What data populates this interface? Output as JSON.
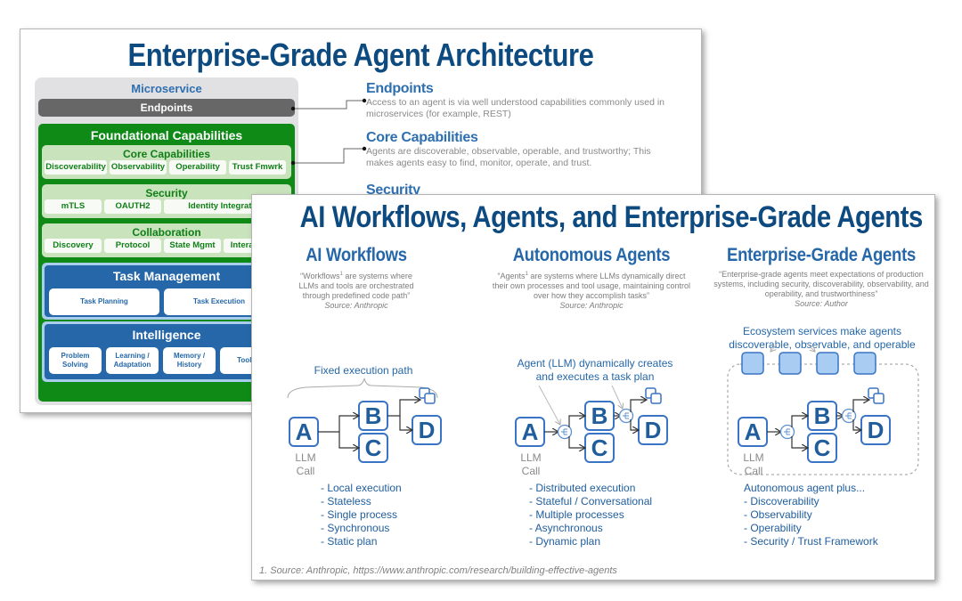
{
  "back_slide": {
    "title": "Enterprise-Grade Agent Architecture",
    "microservice_label": "Microservice",
    "endpoints_label": "Endpoints",
    "foundational_label": "Foundational Capabilities",
    "core": {
      "title": "Core Capabilities",
      "items": [
        "Discoverability",
        "Observability",
        "Operability",
        "Trust Fmwrk"
      ]
    },
    "security": {
      "title": "Security",
      "items": [
        "mTLS",
        "OAUTH2",
        "Identity Integration"
      ]
    },
    "collaboration": {
      "title": "Collaboration",
      "items": [
        "Discovery",
        "Protocol",
        "State Mgmt",
        "Interaction"
      ]
    },
    "task_management": {
      "title": "Task Management",
      "items": [
        "Task Planning",
        "Task Execution"
      ]
    },
    "intelligence": {
      "title": "Intelligence",
      "items": [
        "Problem Solving",
        "Learning / Adaptation",
        "Memory / History",
        "Tools"
      ]
    },
    "descriptions": [
      {
        "heading": "Endpoints",
        "text": "Access to an agent is via well understood capabilities commonly used in microservices (for example, REST)"
      },
      {
        "heading": "Core Capabilities",
        "text": "Agents are discoverable, observable, operable, and trustworthy; This makes agents easy to find, monitor, operate, and trust."
      },
      {
        "heading": "Security",
        "text": ""
      }
    ]
  },
  "front_slide": {
    "title": "AI Workflows, Agents, and Enterprise-Grade Agents",
    "columns": [
      {
        "heading": "AI Workflows",
        "quote_term": "“Workflows",
        "quote_rest": " are systems where LLMs and tools are orchestrated through predefined code path”",
        "source": "Source: Anthropic",
        "diagram_caption": "Fixed execution path",
        "bullets": [
          "-  Local execution",
          "-  Stateless",
          "-  Single process",
          "-  Synchronous",
          "-  Static plan"
        ]
      },
      {
        "heading": "Autonomous Agents",
        "quote_term": "“Agents",
        "quote_rest": " are systems where LLMs dynamically direct their own processes and tool usage, maintaining control over how they accomplish tasks”",
        "source": "Source: Anthropic",
        "diagram_caption": "Agent (LLM) dynamically creates and executes a task plan",
        "bullets": [
          "-  Distributed execution",
          "-  Stateful / Conversational",
          "-  Multiple processes",
          "-  Asynchronous",
          "-  Dynamic plan"
        ]
      },
      {
        "heading": "Enterprise-Grade Agents",
        "quote_term": "",
        "quote_rest": "“Enterprise-grade agents meet expectations of production systems, including security, discoverability, observability, and operability, and trustworthiness”",
        "source": "Source: Author",
        "diagram_caption": "Ecosystem services make agents discoverable, observable, and operable",
        "bullets_intro": "Autonomous agent plus...",
        "bullets": [
          "-  Discoverability",
          "-  Observability",
          "-  Operability",
          "-  Security / Trust Framework"
        ]
      }
    ],
    "footnote_marker": "1",
    "node_labels": {
      "a": "A",
      "b": "B",
      "c": "C",
      "d": "D"
    },
    "llm_label_line1": "LLM",
    "llm_label_line2": "Call",
    "footnote": "1.  Source: Anthropic, https://www.anthropic.com/research/building-effective-agents"
  },
  "colors": {
    "title_navy": "#0d4a80",
    "heading_blue": "#2567a8",
    "green": "#0f8a17",
    "light_green": "#c9e3bd",
    "grey_bar": "#676767",
    "service_fill": "#a9cdf2"
  }
}
